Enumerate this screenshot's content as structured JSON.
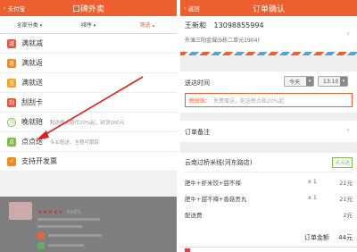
{
  "left": {
    "header": {
      "back_label": "支付宝",
      "title": "口碑外卖"
    },
    "filters": [
      {
        "label": "全部分类",
        "caret": "▾"
      },
      {
        "label": "排序",
        "caret": "▾"
      },
      {
        "label": "筛选",
        "caret": "▴"
      }
    ],
    "menu": [
      {
        "icon": "减",
        "label": "满就减",
        "desc": "",
        "color": "#e8533c"
      },
      {
        "icon": "返",
        "label": "满就返",
        "desc": "",
        "color": "#f08a1c"
      },
      {
        "icon": "送",
        "label": "满就送",
        "desc": "",
        "color": "#f2a21b"
      },
      {
        "icon": "刮",
        "label": "刮刮卡",
        "desc": "",
        "color": "#e8533c"
      },
      {
        "icon": "◷",
        "label": "晚就赔",
        "desc": "配送晚点赔付20%起，封顶100元"
      },
      {
        "icon": "点",
        "label": "点点送",
        "desc": "专业配送，全程可跟踪"
      },
      {
        "icon": "✓",
        "label": "支持开发票",
        "desc": ""
      }
    ],
    "background": {
      "stars": "★★★★★",
      "rating_text": "4985"
    }
  },
  "right": {
    "header": {
      "back_label": "返回",
      "title": "订单确认"
    },
    "address": {
      "name": "王新和",
      "phone": "13098855994",
      "street": "外滩三阳金城(b栋二单元1904)",
      "chevron": "›"
    },
    "delivery": {
      "label": "送达时间",
      "day": "今天",
      "time": "13:10",
      "dropdown": "▾",
      "notice_title": "晚就赔：",
      "notice_desc": "免费赠送，配送晚点赔20%起"
    },
    "remark": {
      "label": "订单备注",
      "chevron": "›"
    },
    "order": {
      "shop": "云南过桥米线(河东路店)",
      "badge": "点点送",
      "items": [
        {
          "name": "肥牛+虾米饺+甜不辣",
          "qty": "x 1",
          "price": "21元"
        },
        {
          "name": "肥牛+甜不辣+香菇贡丸",
          "qty": "x 1",
          "price": "21元"
        },
        {
          "name": "配送费",
          "qty": "",
          "price": "2元"
        }
      ],
      "total_label": "订单金额",
      "total_value": "44元"
    },
    "colors": {
      "accent": "#ec6030",
      "green": "#7bbf4a"
    }
  }
}
